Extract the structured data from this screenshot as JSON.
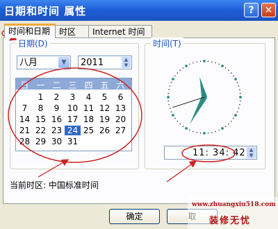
{
  "window": {
    "title": "日期和时间 属性",
    "help_label": "?",
    "close_label": "✕"
  },
  "tabs": [
    {
      "label": "时间和日期",
      "active": true
    },
    {
      "label": "时区",
      "active": false
    },
    {
      "label": "Internet 时间",
      "active": false
    }
  ],
  "date_group": {
    "label": "日期(D)",
    "month": "八月",
    "year": "2011",
    "weekdays": [
      "日",
      "一",
      "二",
      "三",
      "四",
      "五",
      "六"
    ],
    "days": [
      [
        "",
        "1",
        "2",
        "3",
        "4",
        "5",
        "6"
      ],
      [
        "7",
        "8",
        "9",
        "10",
        "11",
        "12",
        "13"
      ],
      [
        "14",
        "15",
        "16",
        "17",
        "18",
        "19",
        "20"
      ],
      [
        "21",
        "22",
        "23",
        "24",
        "25",
        "26",
        "27"
      ],
      [
        "28",
        "29",
        "30",
        "31",
        "",
        "",
        ""
      ]
    ],
    "selected_day": "24"
  },
  "time_group": {
    "label": "时间(T)",
    "value": "11: 34: 42",
    "hour": 11,
    "minute": 34,
    "second": 42
  },
  "timezone_text": "当前时区: 中国标准时间",
  "buttons": {
    "ok": "确定",
    "cancel": "取"
  },
  "watermark": {
    "url": "www.zhuangxiu518.com",
    "name": "装修无忧"
  },
  "colors": {
    "title_bar": "#1f5fd6",
    "annotation": "#cc2222",
    "selected_day": "#316ac5",
    "clock_hands": "#2e8b84"
  }
}
